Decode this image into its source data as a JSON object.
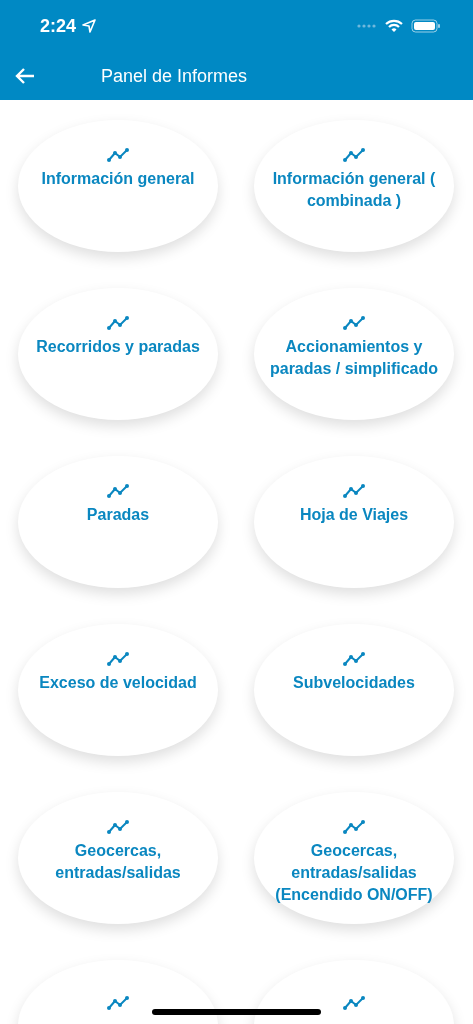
{
  "status_bar": {
    "time": "2:24"
  },
  "header": {
    "title": "Panel de Informes"
  },
  "reports": [
    {
      "label": "Información general"
    },
    {
      "label": "Información general ( combinada )"
    },
    {
      "label": "Recorridos y paradas"
    },
    {
      "label": "Accionamientos y paradas / simplificado"
    },
    {
      "label": "Paradas"
    },
    {
      "label": "Hoja de Viajes"
    },
    {
      "label": "Exceso de velocidad"
    },
    {
      "label": "Subvelocidades"
    },
    {
      "label": "Geocercas, entradas/salidas"
    },
    {
      "label": "Geocercas, entradas/salidas (Encendido ON/OFF)"
    },
    {
      "kind": "cut_off"
    },
    {
      "kind": "cut_off"
    }
  ]
}
